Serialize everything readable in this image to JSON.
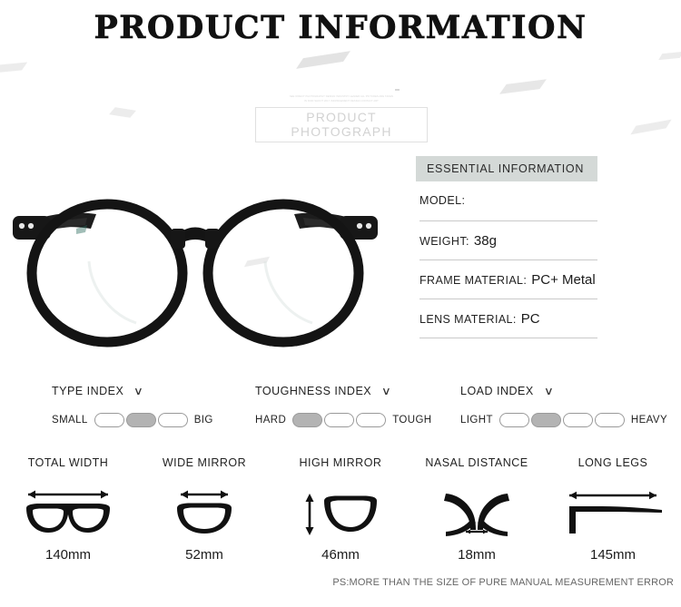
{
  "header": {
    "title": "PRODUCT INFORMATION"
  },
  "watermark": {
    "line1": "SEE DIRECT PHOTOGRAPHY DESIGN INDUSTRY LEADER ALL PICTURES ARE TAKEN",
    "line2": "IN KIND SHOOT 2017 INFRINGEMENT DESIGN CONTACT ART",
    "box_label": "PRODUCT PHOTOGRAPH"
  },
  "photo": {
    "alt_name": "black-round-eyeglasses"
  },
  "essential": {
    "heading": "ESSENTIAL INFORMATION",
    "rows": [
      {
        "label": "MODEL:",
        "value": ""
      },
      {
        "label": "WEIGHT:",
        "value": "38g"
      },
      {
        "label": "FRAME MATERIAL:",
        "value": "PC+ Metal"
      },
      {
        "label": "LENS MATERIAL:",
        "value": "PC"
      }
    ]
  },
  "indexes": [
    {
      "title": "TYPE INDEX",
      "chevron": "∨",
      "low_label": "SMALL",
      "high_label": "BIG",
      "steps": 3,
      "active": 2
    },
    {
      "title": "TOUGHNESS INDEX",
      "chevron": "∨",
      "low_label": "HARD",
      "high_label": "TOUGH",
      "steps": 3,
      "active": 1
    },
    {
      "title": "LOAD INDEX",
      "chevron": "∨",
      "low_label": "LIGHT",
      "high_label": "HEAVY",
      "steps": 4,
      "active": 2
    }
  ],
  "measurements": [
    {
      "label": "TOTAL WIDTH",
      "value": "140mm",
      "icon": "glasses-full-width-icon"
    },
    {
      "label": "WIDE MIRROR",
      "value": "52mm",
      "icon": "lens-width-icon"
    },
    {
      "label": "HIGH MIRROR",
      "value": "46mm",
      "icon": "lens-height-icon"
    },
    {
      "label": "NASAL DISTANCE",
      "value": "18mm",
      "icon": "bridge-width-icon"
    },
    {
      "label": "LONG LEGS",
      "value": "145mm",
      "icon": "temple-length-icon"
    }
  ],
  "footer": {
    "note": "PS:MORE THAN THE SIZE OF PURE MANUAL MEASUREMENT ERROR"
  },
  "colors": {
    "panel_header_bg": "#d4d9d7",
    "pill_active": "#b3b3b3",
    "pill_border": "#9a9a9a",
    "rule": "#c9c9c9",
    "text": "#1a1a1a",
    "watermark": "#d5d5d5"
  }
}
